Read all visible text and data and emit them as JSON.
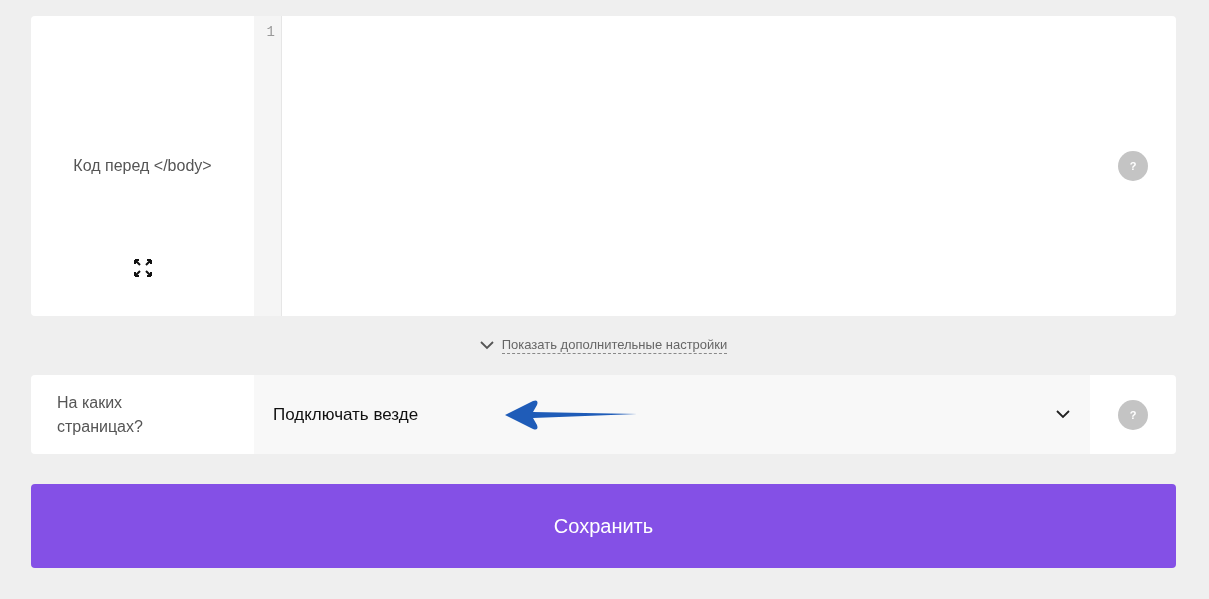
{
  "code_field": {
    "label": "Код перед </body>",
    "line_numbers": [
      "1"
    ],
    "help": "?"
  },
  "more_settings_link": {
    "label": "Показать дополнительные настройки",
    "expanded": false
  },
  "pages_field": {
    "label": "На каких страницах?",
    "value": "Подключать везде",
    "help": "?"
  },
  "save_button": {
    "label": "Сохранить"
  }
}
